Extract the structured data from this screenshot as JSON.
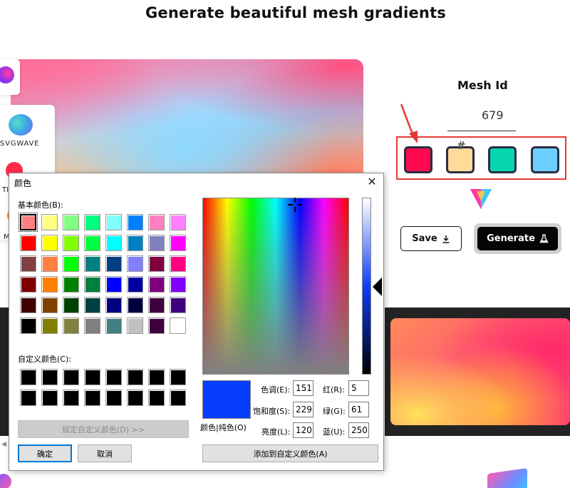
{
  "page": {
    "title": "Generate beautiful mesh gradients"
  },
  "sidebar": {
    "items": [
      {
        "label": "SVGWAVE",
        "icon": "blob-icon"
      },
      {
        "label": "TI",
        "icon": "dot-icon"
      },
      {
        "label": "M",
        "icon": "dot-icon"
      }
    ]
  },
  "mesh": {
    "id_label": "Mesh Id",
    "id_value": "679",
    "hash_text": "#",
    "swatches": [
      {
        "color": "#ff0a50"
      },
      {
        "color": "#ffdb9a"
      },
      {
        "color": "#06d6b0"
      },
      {
        "color": "#6ccfff"
      }
    ]
  },
  "buttons": {
    "save": "Save",
    "save_icon": "download-icon",
    "generate": "Generate",
    "generate_icon": "flask-icon"
  },
  "dialog": {
    "title": "颜色",
    "close": "✕",
    "basic_label": "基本颜色(B):",
    "custom_label": "自定义颜色(C):",
    "define_custom": "规定自定义颜色(D) >>",
    "ok": "确定",
    "cancel": "取消",
    "add_custom": "添加到自定义颜色(A)",
    "preview_label": "颜色|纯色(O)",
    "fields": {
      "hue_label": "色调(E):",
      "hue": "151",
      "sat_label": "饱和度(S):",
      "sat": "229",
      "lum_label": "亮度(L):",
      "lum": "120",
      "red_label": "红(R):",
      "red": "5",
      "green_label": "绿(G):",
      "green": "61",
      "blue_label": "蓝(U):",
      "blue": "250"
    },
    "basic_colors": [
      "#ff8080",
      "#ffff80",
      "#80ff80",
      "#00ff80",
      "#80ffff",
      "#0080ff",
      "#ff80c0",
      "#ff80ff",
      "#ff0000",
      "#ffff00",
      "#80ff00",
      "#00ff40",
      "#00ffff",
      "#0080c0",
      "#8080c0",
      "#ff00ff",
      "#804040",
      "#ff8040",
      "#00ff00",
      "#008080",
      "#004080",
      "#8080ff",
      "#800040",
      "#ff0080",
      "#800000",
      "#ff8000",
      "#008000",
      "#008040",
      "#0000ff",
      "#0000a0",
      "#800080",
      "#8000ff",
      "#400000",
      "#804000",
      "#004000",
      "#004040",
      "#000080",
      "#000040",
      "#400040",
      "#400080",
      "#000000",
      "#808000",
      "#808040",
      "#808080",
      "#408080",
      "#c0c0c0",
      "#400040",
      "#ffffff"
    ],
    "custom_colors": [
      "#000000",
      "#000000",
      "#000000",
      "#000000",
      "#000000",
      "#000000",
      "#000000",
      "#000000",
      "#000000",
      "#000000",
      "#000000",
      "#000000",
      "#000000",
      "#000000",
      "#000000",
      "#000000"
    ],
    "current_color": "#053dfa"
  }
}
